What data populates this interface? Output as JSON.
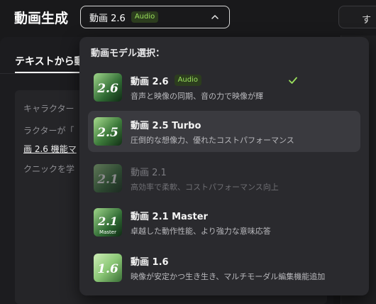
{
  "header": {
    "title": "動画生成",
    "selected_model": "動画 2.6",
    "selected_badge": "Audio",
    "right_button_label": "す"
  },
  "left": {
    "tab_label": "テキストから動",
    "prompt_lines": [
      "キャラクター",
      "ラクターが「",
      "クニックを学"
    ],
    "prompt_link": "画 2.6 機能マ"
  },
  "dropdown": {
    "title": "動画モデル選択：",
    "options": [
      {
        "name": "動画 2.6",
        "badge": "Audio",
        "desc": "音声と映像の同期、音の力で映像が輝",
        "thumb_label": "2.6",
        "selected": true,
        "disabled": false
      },
      {
        "name": "動画 2.5 Turbo",
        "desc": "圧倒的な想像力、優れたコストパフォーマンス",
        "thumb_label": "2.5",
        "selected": false,
        "disabled": false
      },
      {
        "name": "動画 2.1",
        "desc": "高効率で柔軟、コストパフォーマンス向上",
        "thumb_label": "2.1",
        "selected": false,
        "disabled": true
      },
      {
        "name": "動画 2.1 Master",
        "desc": "卓越した動作性能、より強力な意味応答",
        "thumb_label": "2.1",
        "thumb_sub": "Master",
        "selected": false,
        "disabled": false
      },
      {
        "name": "動画 1.6",
        "desc": "映像が安定かつ生き生き、マルチモーダル編集機能追加",
        "thumb_label": "1.6",
        "selected": false,
        "disabled": false
      }
    ]
  },
  "colors": {
    "accent_green": "#9be15d",
    "badge_bg": "#2c3d1e",
    "dropdown_bg": "#2a2a2e",
    "hover_bg": "#3a3a3f"
  },
  "icons": {
    "select_chevron": "chevron-up-icon",
    "selected_check": "check-icon"
  }
}
